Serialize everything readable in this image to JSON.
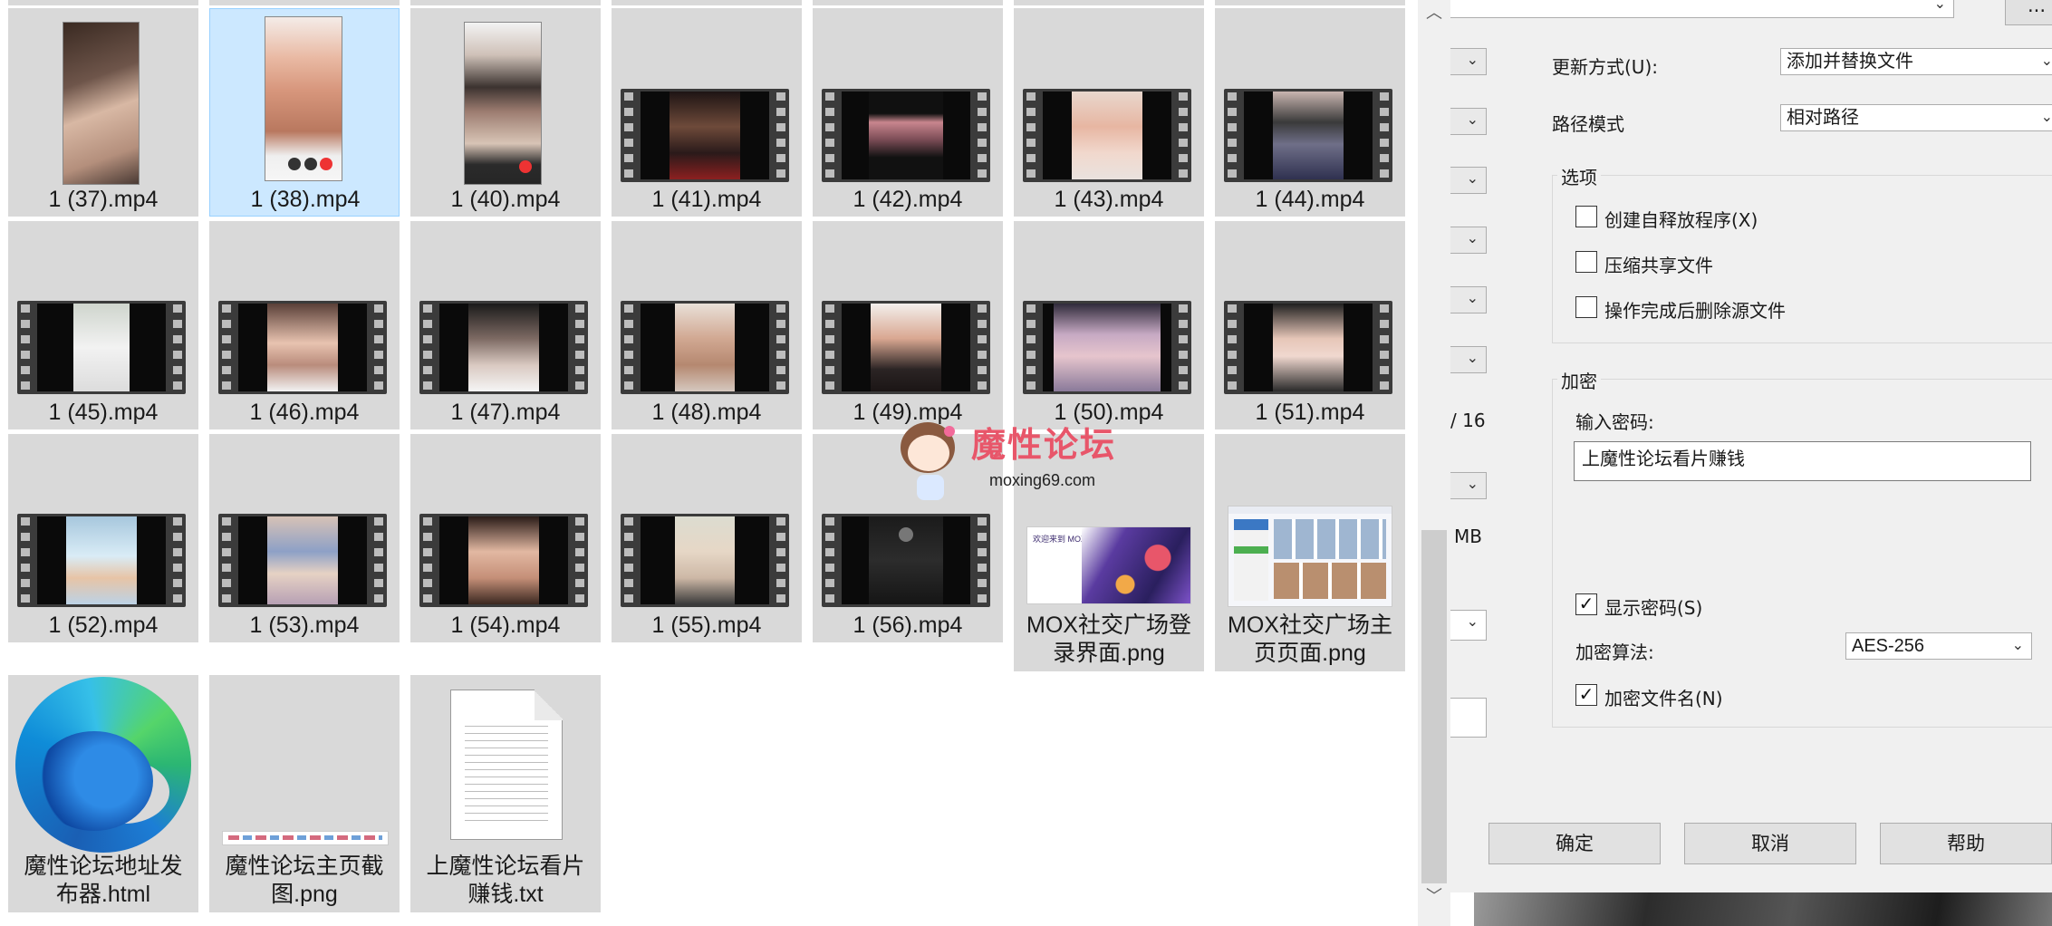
{
  "explorer": {
    "files": [
      {
        "name": "1 (37).mp4"
      },
      {
        "name": "1 (38).mp4"
      },
      {
        "name": "1 (40).mp4"
      },
      {
        "name": "1 (41).mp4"
      },
      {
        "name": "1 (42).mp4"
      },
      {
        "name": "1 (43).mp4"
      },
      {
        "name": "1 (44).mp4"
      },
      {
        "name": "1 (45).mp4"
      },
      {
        "name": "1 (46).mp4"
      },
      {
        "name": "1 (47).mp4"
      },
      {
        "name": "1 (48).mp4"
      },
      {
        "name": "1 (49).mp4"
      },
      {
        "name": "1 (50).mp4"
      },
      {
        "name": "1 (51).mp4"
      },
      {
        "name": "1 (52).mp4"
      },
      {
        "name": "1 (53).mp4"
      },
      {
        "name": "1 (54).mp4"
      },
      {
        "name": "1 (55).mp4"
      },
      {
        "name": "1 (56).mp4"
      },
      {
        "name": "MOX社交广场登录界面.png",
        "line1": "MOX社交广场登",
        "line2": "录界面.png"
      },
      {
        "name": "MOX社交广场主页页面.png",
        "line1": "MOX社交广场主",
        "line2": "页页面.png"
      },
      {
        "name": "魔性论坛地址发布器.html",
        "line1": "魔性论坛地址发",
        "line2": "布器.html"
      },
      {
        "name": "魔性论坛主页截图.png",
        "line1": "魔性论坛主页截",
        "line2": "图.png"
      },
      {
        "name": "上魔性论坛看片赚钱.txt",
        "line1": "上魔性论坛看片",
        "line2": "赚钱.txt"
      }
    ],
    "selected_file": "1 (38).mp4",
    "thumb_texts": {
      "mox_banner": "欢迎来到 MOX"
    }
  },
  "watermark": {
    "title": "魔性论坛",
    "url": "moxing69.com"
  },
  "dialog": {
    "update_mode_label": "更新方式(U):",
    "update_mode_value": "添加并替换文件",
    "path_mode_label": "路径模式",
    "path_mode_value": "相对路径",
    "options_title": "选项",
    "opt_sfx": "创建自释放程序(X)",
    "opt_shared": "压缩共享文件",
    "opt_delete": "操作完成后删除源文件",
    "encryption_title": "加密",
    "password_label": "输入密码:",
    "password_value": "上魔性论坛看片赚钱",
    "show_password": "显示密码(S)",
    "algorithm_label": "加密算法:",
    "algorithm_value": "AES-256",
    "encrypt_names": "加密文件名(N)",
    "ok": "确定",
    "cancel": "取消",
    "help": "帮助",
    "browse": "...",
    "frag_threads": "/ 16",
    "frag_mb": "MB",
    "checkbox_mark": "✓"
  },
  "colors": {
    "tile": "#d9d9d9",
    "selected": "#cce8ff",
    "dialog": "#f0f0f0"
  }
}
